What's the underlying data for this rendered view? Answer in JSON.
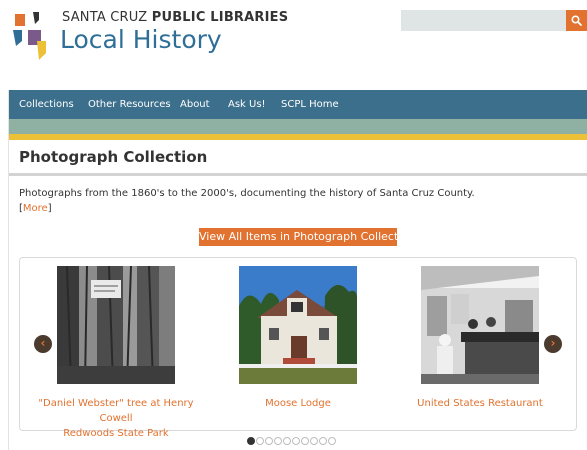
{
  "header": {
    "site_name_prefix": "SANTA CRUZ",
    "site_name_bold": "PUBLIC LIBRARIES",
    "site_title": "Local History",
    "search": {
      "value": "",
      "placeholder": ""
    }
  },
  "nav": {
    "items": [
      {
        "label": "Collections"
      },
      {
        "label": "Other Resources"
      },
      {
        "label": "About"
      },
      {
        "label": "Ask Us!"
      },
      {
        "label": "SCPL Home"
      }
    ]
  },
  "section": {
    "title": "Photograph Collection",
    "description": "Photographs from the 1860's to the 2000's, documenting the history of Santa Cruz County.",
    "more_open": "[",
    "more_label": "More",
    "more_close": "]",
    "view_all_label": "View All Items in Photograph Collection"
  },
  "carousel": {
    "items": [
      {
        "caption_line1": "\"Daniel Webster\" tree at Henry Cowell",
        "caption_line2": "Redwoods State Park"
      },
      {
        "caption_line1": "Moose Lodge",
        "caption_line2": ""
      },
      {
        "caption_line1": "United States Restaurant",
        "caption_line2": ""
      }
    ],
    "prev_icon": "‹",
    "next_icon": "›",
    "page_count": 10,
    "active_page": 1
  },
  "colors": {
    "accent": "#e1722f",
    "nav": "#3c6f8c",
    "title": "#2f6f97",
    "band_green": "#8fb1a3",
    "band_yellow": "#ecc037"
  },
  "icons": {
    "logo": "library-logo-icon",
    "search": "search-icon",
    "prev": "chevron-left-icon",
    "next": "chevron-right-icon"
  }
}
